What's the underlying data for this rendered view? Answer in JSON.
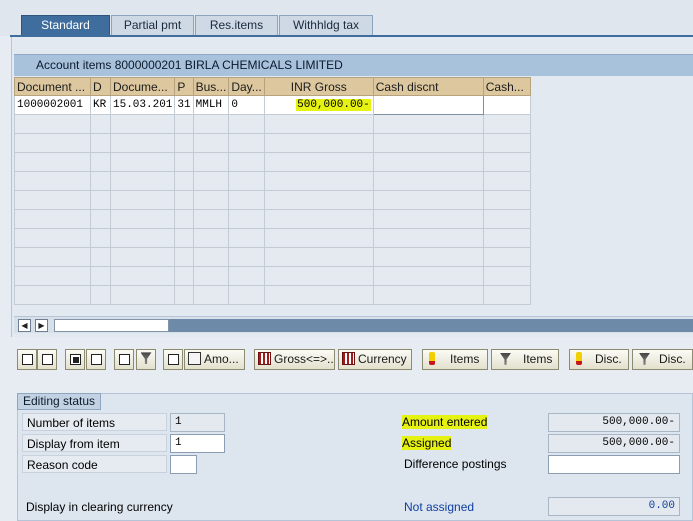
{
  "tabs": [
    {
      "label": "Standard"
    },
    {
      "label": "Partial pmt"
    },
    {
      "label": "Res.items"
    },
    {
      "label": "Withhldg tax"
    }
  ],
  "account_items": {
    "caption": "Account items 8000000201 BIRLA CHEMICALS LIMITED",
    "columns": [
      "Document ...",
      "D",
      "Docume...",
      "P",
      "Bus...",
      "Day...",
      "INR Gross",
      "Cash discnt",
      "Cash..."
    ],
    "rows": [
      {
        "document": "1000002001",
        "d": "KR",
        "date": "15.03.201",
        "p": "31",
        "bus": "MMLH",
        "day": "0",
        "gross": "500,000.00-",
        "cash_discnt": "",
        "cash": ""
      }
    ]
  },
  "toolbar": {
    "amount_label": "Amo...",
    "gross_label": "Gross<=>...",
    "currency_label": "Currency",
    "items1_label": "Items",
    "items2_label": "Items",
    "disc1_label": "Disc.",
    "disc2_label": "Disc."
  },
  "editing_status": {
    "title": "Editing status",
    "number_of_items_label": "Number of items",
    "number_of_items_value": "1",
    "display_from_item_label": "Display from item",
    "display_from_item_value": "1",
    "reason_code_label": "Reason code",
    "reason_code_value": "",
    "display_clearing_currency_label": "Display in clearing currency",
    "amount_entered_label": "Amount entered",
    "amount_entered_value": "500,000.00-",
    "assigned_label": "Assigned",
    "assigned_value": "500,000.00-",
    "difference_postings_label": "Difference postings",
    "difference_postings_value": "",
    "not_assigned_label": "Not assigned",
    "not_assigned_value": "0.00"
  },
  "colors": {
    "tab_active": "#3f6d9e",
    "header_bg": "#dcc79f",
    "highlight": "#e6f212",
    "link_blue": "#1040a0"
  }
}
